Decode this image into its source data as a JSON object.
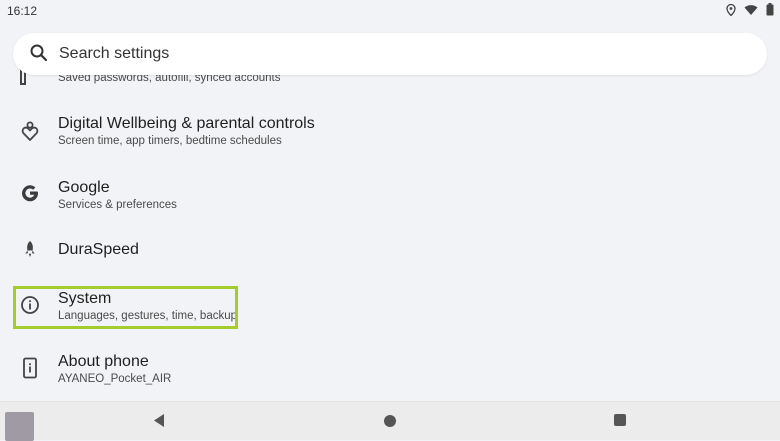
{
  "status": {
    "time": "16:12"
  },
  "search": {
    "placeholder": "Search settings"
  },
  "items": [
    {
      "title": "",
      "summary": "Saved passwords, autofill, synced accounts",
      "icon": "key-icon"
    },
    {
      "title": "Digital Wellbeing & parental controls",
      "summary": "Screen time, app timers, bedtime schedules",
      "icon": "wellbeing-icon"
    },
    {
      "title": "Google",
      "summary": "Services & preferences",
      "icon": "google-icon"
    },
    {
      "title": "DuraSpeed",
      "summary": "",
      "icon": "rocket-icon"
    },
    {
      "title": "System",
      "summary": "Languages, gestures, time, backup",
      "icon": "info-icon"
    },
    {
      "title": "About phone",
      "summary": "AYANEO_Pocket_AIR",
      "icon": "phone-icon"
    }
  ],
  "colors": {
    "highlight": "#a5cc2e",
    "background": "#f1f3f6"
  }
}
